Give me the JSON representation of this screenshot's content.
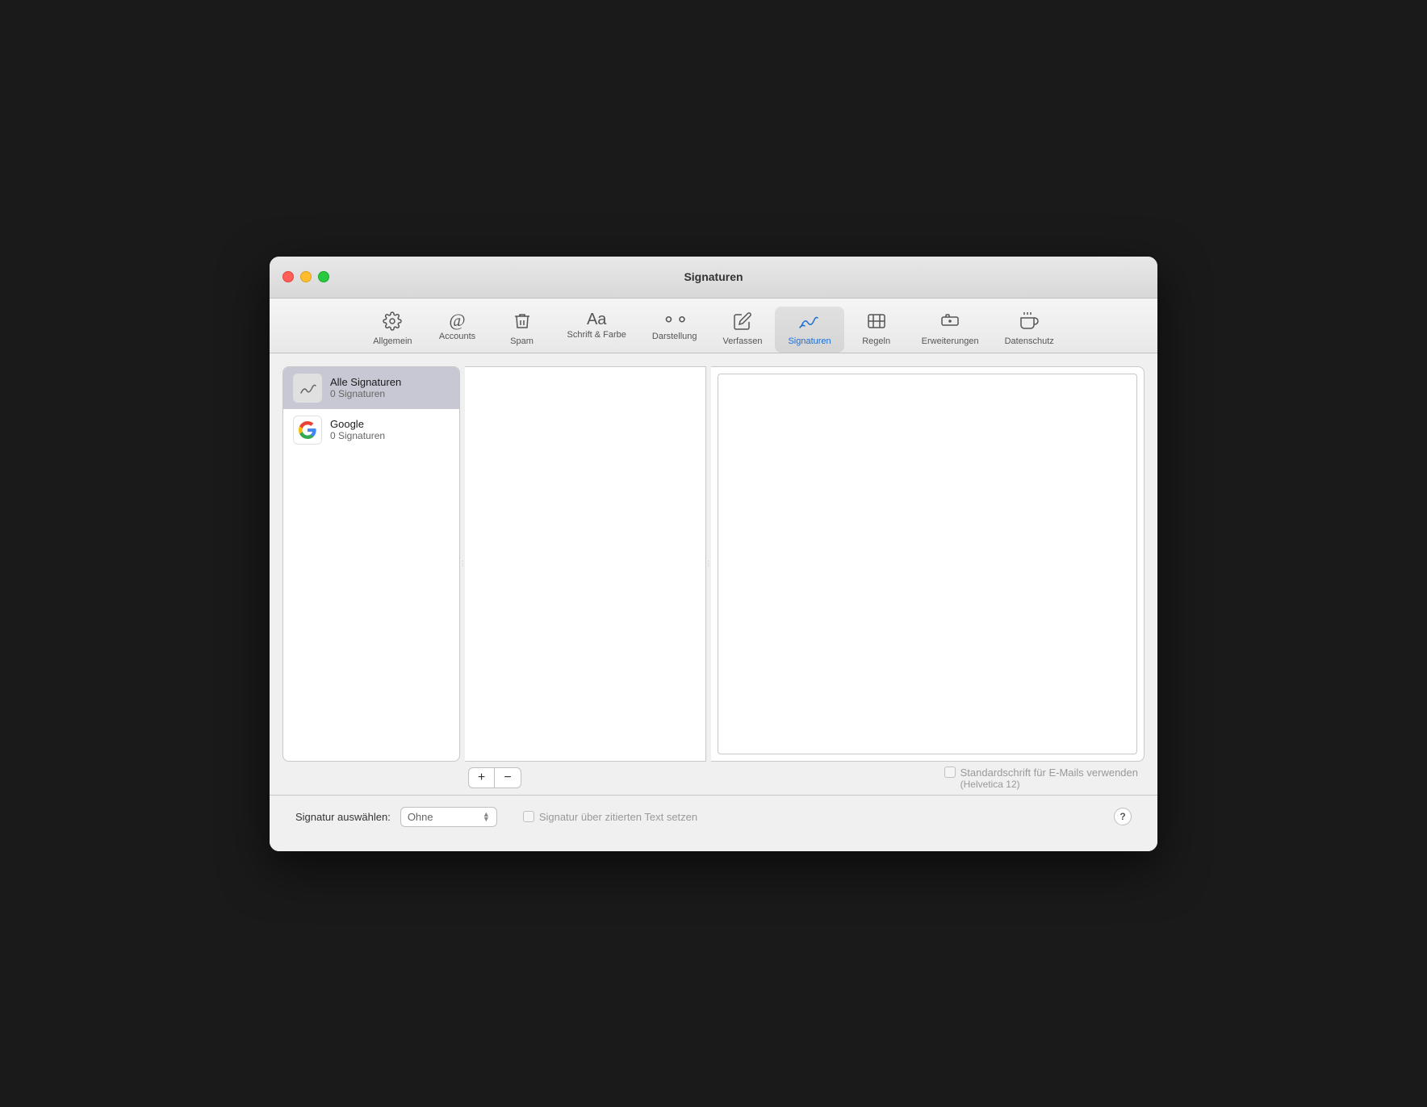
{
  "window": {
    "title": "Signaturen"
  },
  "toolbar": {
    "items": [
      {
        "id": "allgemein",
        "label": "Allgemein",
        "icon": "⚙️",
        "active": false
      },
      {
        "id": "accounts",
        "label": "Accounts",
        "icon": "@",
        "active": false
      },
      {
        "id": "spam",
        "label": "Spam",
        "icon": "🗑️",
        "active": false
      },
      {
        "id": "schrift",
        "label": "Schrift & Farbe",
        "icon": "Aa",
        "active": false
      },
      {
        "id": "darstellung",
        "label": "Darstellung",
        "icon": "👓",
        "active": false
      },
      {
        "id": "verfassen",
        "label": "Verfassen",
        "icon": "✏️",
        "active": false
      },
      {
        "id": "signaturen",
        "label": "Signaturen",
        "icon": "✍️",
        "active": true
      },
      {
        "id": "regeln",
        "label": "Regeln",
        "icon": "📬",
        "active": false
      },
      {
        "id": "erweiterungen",
        "label": "Erweiterungen",
        "icon": "🔌",
        "active": false
      },
      {
        "id": "datenschutz",
        "label": "Datenschutz",
        "icon": "✋",
        "active": false
      }
    ]
  },
  "accounts_panel": {
    "items": [
      {
        "id": "all",
        "name": "Alle Signaturen",
        "count": "0 Signaturen",
        "selected": true,
        "icon": "sig"
      },
      {
        "id": "google",
        "name": "Google",
        "count": "0 Signaturen",
        "selected": false,
        "icon": "G"
      }
    ]
  },
  "add_button": "+",
  "remove_button": "−",
  "font_option": {
    "label": "Standardschrift für E-Mails verwenden",
    "sublabel": "(Helvetica 12)"
  },
  "footer": {
    "select_label": "Signatur auswählen:",
    "select_value": "Ohne",
    "checkbox_label": "Signatur über zitierten Text setzen"
  },
  "help": "?"
}
